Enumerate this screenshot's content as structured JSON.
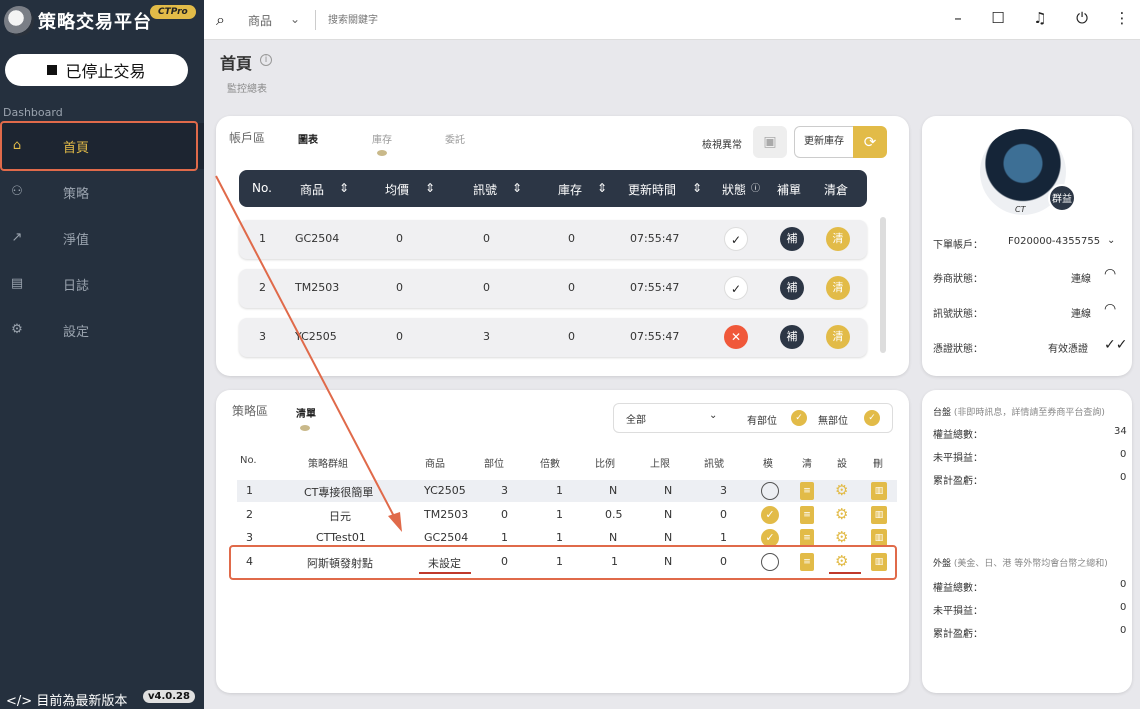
{
  "app": {
    "title": "策略交易平台",
    "badge": "CTPro",
    "status_button": "已停止交易",
    "section_label": "Dashboard",
    "version_text": "目前為最新版本",
    "version": "v4.0.28"
  },
  "nav": [
    {
      "label": "首頁",
      "icon": "home-icon"
    },
    {
      "label": "策略",
      "icon": "strategy-icon"
    },
    {
      "label": "淨值",
      "icon": "chart-icon"
    },
    {
      "label": "日誌",
      "icon": "log-icon"
    },
    {
      "label": "設定",
      "icon": "gear-icon"
    }
  ],
  "topbar": {
    "category": "商品",
    "search_placeholder": "搜索關鍵字"
  },
  "page": {
    "title": "首頁",
    "subtitle": "監控總表"
  },
  "account": {
    "title": "帳戶區",
    "tabs": [
      "圖表",
      "庫存",
      "委託"
    ],
    "check_label": "檢視異常",
    "update_label": "更新庫存",
    "columns": [
      "No.",
      "商品",
      "均價",
      "訊號",
      "庫存",
      "更新時間",
      "狀態",
      "補單",
      "清倉"
    ],
    "bu_label": "補",
    "qing_label": "清",
    "rows": [
      {
        "no": "1",
        "symbol": "GC2504",
        "avg": "0",
        "signal": "0",
        "stock": "0",
        "time": "07:55:47",
        "ok": true
      },
      {
        "no": "2",
        "symbol": "TM2503",
        "avg": "0",
        "signal": "0",
        "stock": "0",
        "time": "07:55:47",
        "ok": true
      },
      {
        "no": "3",
        "symbol": "YC2505",
        "avg": "0",
        "signal": "3",
        "stock": "0",
        "time": "07:55:47",
        "ok": false
      }
    ]
  },
  "strategy": {
    "title": "策略區",
    "tab": "清單",
    "filter": "全部",
    "has_pos": "有部位",
    "no_pos": "無部位",
    "columns": [
      "No.",
      "策略群組",
      "商品",
      "部位",
      "倍數",
      "比例",
      "上限",
      "訊號",
      "模",
      "清",
      "設",
      "刪"
    ],
    "rows": [
      {
        "no": "1",
        "group": "CT專接很簡單",
        "symbol": "YC2505",
        "pos": "3",
        "mult": "1",
        "ratio": "N",
        "limit": "N",
        "signal": "3",
        "mode": false
      },
      {
        "no": "2",
        "group": "日元",
        "symbol": "TM2503",
        "pos": "0",
        "mult": "1",
        "ratio": "0.5",
        "limit": "N",
        "signal": "0",
        "mode": true
      },
      {
        "no": "3",
        "group": "CTTest01",
        "symbol": "GC2504",
        "pos": "1",
        "mult": "1",
        "ratio": "N",
        "limit": "N",
        "signal": "1",
        "mode": true
      },
      {
        "no": "4",
        "group": "阿斯頓發射點",
        "symbol": "未設定",
        "pos": "0",
        "mult": "1",
        "ratio": "1",
        "limit": "N",
        "signal": "0",
        "mode": false
      }
    ]
  },
  "profile": {
    "avatar_text": "CT",
    "badge": "群益",
    "account_label": "下單帳戶：",
    "account_value": "F020000-4355755",
    "broker_label": "券商狀態：",
    "broker_value": "連線",
    "signal_label": "訊號狀態：",
    "signal_value": "連線",
    "cert_label": "憑證狀態：",
    "cert_value": "有效憑證"
  },
  "domestic": {
    "title": "台盤",
    "note": "(非即時訊息，詳情請至券商平台查詢)",
    "rows": [
      {
        "label": "權益總數：",
        "value": "34"
      },
      {
        "label": "未平損益：",
        "value": "0"
      },
      {
        "label": "累計盈虧：",
        "value": "0"
      }
    ]
  },
  "foreign": {
    "title": "外盤",
    "note": "(美金、日、港 等外幣均會台幣之總和)",
    "rows": [
      {
        "label": "權益總數：",
        "value": "0"
      },
      {
        "label": "未平損益：",
        "value": "0"
      },
      {
        "label": "累計盈虧：",
        "value": "0"
      }
    ]
  }
}
